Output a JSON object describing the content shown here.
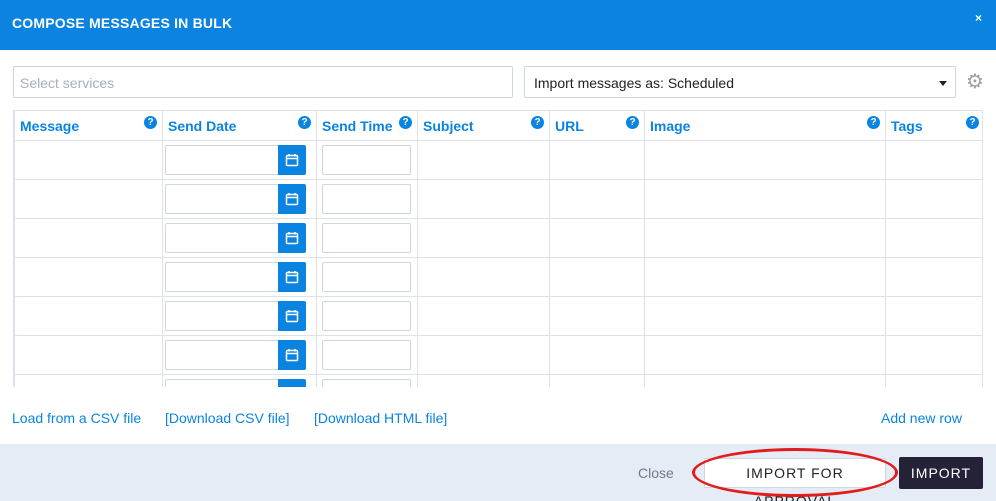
{
  "header": {
    "title": "COMPOSE MESSAGES IN BULK",
    "close_glyph": "×"
  },
  "controls": {
    "services_placeholder": "Select services",
    "import_as_value": "Import messages as: Scheduled",
    "gear_icon": "gear-icon"
  },
  "table": {
    "columns": [
      {
        "label": "Message",
        "help": "?"
      },
      {
        "label": "Send Date",
        "help": "?"
      },
      {
        "label": "Send Time",
        "help": "?"
      },
      {
        "label": "Subject",
        "help": "?"
      },
      {
        "label": "URL",
        "help": "?"
      },
      {
        "label": "Image",
        "help": "?"
      },
      {
        "label": "Tags",
        "help": "?"
      }
    ],
    "visible_rows": 7
  },
  "links": {
    "load_csv": "Load from a CSV file",
    "download_csv": "[Download CSV file]",
    "download_html": "[Download HTML file]",
    "add_row": "Add new row"
  },
  "actions": {
    "close": "Close",
    "import_for_approval": "IMPORT FOR APPROVAL",
    "import": "IMPORT"
  },
  "colors": {
    "accent": "#0a84e0",
    "dark_button": "#252238",
    "highlight": "#e21b1b",
    "footer_bg": "#e6ecf5"
  }
}
